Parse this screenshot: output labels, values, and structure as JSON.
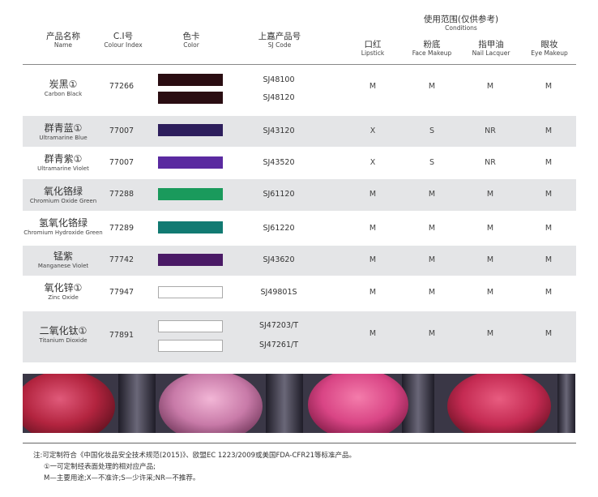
{
  "header": {
    "name": {
      "zh": "产品名称",
      "en": "Name"
    },
    "ci": {
      "zh": "C.I号",
      "en": "Colour Index"
    },
    "color": {
      "zh": "色卡",
      "en": "Color"
    },
    "sj": {
      "zh": "上嘉产品号",
      "en": "SJ Code"
    },
    "usage_group": {
      "zh": "使用范围(仅供参考)",
      "en": "Conditions"
    },
    "usage_cols": [
      {
        "zh": "口红",
        "en": "Lipstick"
      },
      {
        "zh": "粉底",
        "en": "Face Makeup"
      },
      {
        "zh": "指甲油",
        "en": "Nail Lacquer"
      },
      {
        "zh": "眼妆",
        "en": "Eye Makeup"
      }
    ]
  },
  "rows": [
    {
      "zh": "炭黑①",
      "en": "Carbon Black",
      "ci": "77266",
      "swatches": [
        "#2a0d12",
        "#2a0d12"
      ],
      "sj": [
        "SJ48100",
        "SJ48120"
      ],
      "usage": [
        "M",
        "M",
        "M",
        "M"
      ]
    },
    {
      "zh": "群青蓝①",
      "en": "Ultramarine Blue",
      "ci": "77007",
      "swatches": [
        "#2d1e5c"
      ],
      "sj": [
        "SJ43120"
      ],
      "usage": [
        "X",
        "S",
        "NR",
        "M"
      ]
    },
    {
      "zh": "群青紫①",
      "en": "Ultramarine Violet",
      "ci": "77007",
      "swatches": [
        "#5a2aa0"
      ],
      "sj": [
        "SJ43520"
      ],
      "usage": [
        "X",
        "S",
        "NR",
        "M"
      ]
    },
    {
      "zh": "氧化铬绿",
      "en": "Chromium Oxide Green",
      "ci": "77288",
      "swatches": [
        "#1a9a5c"
      ],
      "sj": [
        "SJ61120"
      ],
      "usage": [
        "M",
        "M",
        "M",
        "M"
      ]
    },
    {
      "zh": "氢氧化铬绿",
      "en": "Chromium Hydroxide Green",
      "ci": "77289",
      "swatches": [
        "#117a72"
      ],
      "sj": [
        "SJ61220"
      ],
      "usage": [
        "M",
        "M",
        "M",
        "M"
      ]
    },
    {
      "zh": "锰紫",
      "en": "Manganese Violet",
      "ci": "77742",
      "swatches": [
        "#4a1a66"
      ],
      "sj": [
        "SJ43620"
      ],
      "usage": [
        "M",
        "M",
        "M",
        "M"
      ]
    },
    {
      "zh": "氧化锌①",
      "en": "Zinc Oxide",
      "ci": "77947",
      "swatches": [
        "#ffffff"
      ],
      "sj": [
        "SJ49801S"
      ],
      "usage": [
        "M",
        "M",
        "M",
        "M"
      ]
    },
    {
      "zh": "二氧化钛①",
      "en": "Titanium Dioxide",
      "ci": "77891",
      "swatches": [
        "#ffffff",
        "#ffffff"
      ],
      "sj": [
        "SJ47203/T",
        "SJ47261/T"
      ],
      "usage": [
        "M",
        "M",
        "M",
        "M"
      ]
    }
  ],
  "notes": [
    "注:可定制符合《中国化妆品安全技术规范(2015)》、欧盟EC 1223/2009或美国FDA-CFR21等标准产品。",
    "①一可定制经表面处理的相对应产品;",
    "M—主要用途;X—不准许;S—少许采;NR—不推荐。"
  ]
}
